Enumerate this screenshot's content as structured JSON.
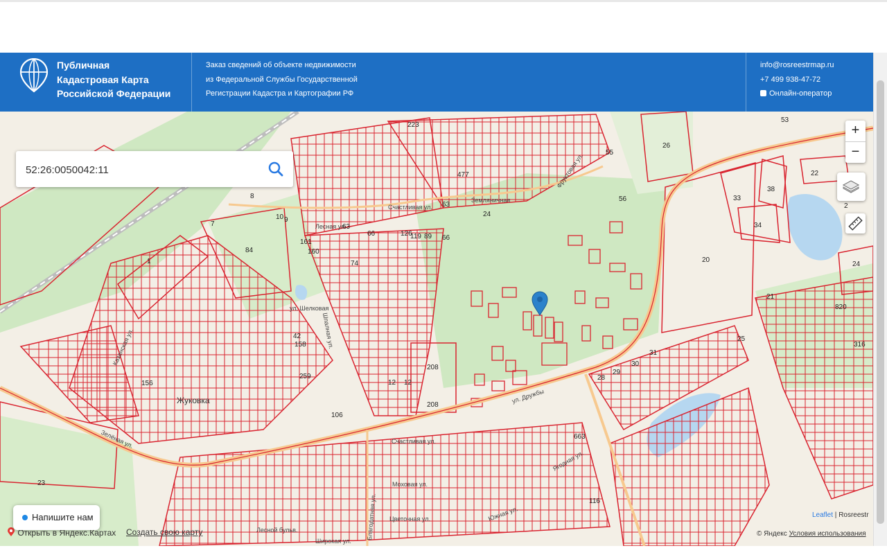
{
  "header": {
    "brand_line1": "Публичная",
    "brand_line2": "Кадастровая Карта",
    "brand_line3": "Российской Федерации",
    "order_line1": "Заказ сведений об объекте недвижимости",
    "order_line2": "из Федеральной Службы Государственной",
    "order_line3": "Регистрации Кадастра и Картографии РФ",
    "email": "info@rosreestrmap.ru",
    "phone": "+7 499 938-47-72",
    "operator": "Онлайн-оператор"
  },
  "search": {
    "value": "52:26:0050042:11"
  },
  "controls": {
    "zoom_in": "+",
    "zoom_out": "−"
  },
  "chat": {
    "label": "Напишите нам"
  },
  "yandex": {
    "open": "Открыть в Яндекс.Картах",
    "create": "Создать свою карту",
    "copyright": "© Яндекс",
    "terms": "Условия использования"
  },
  "attribution": {
    "leaflet": "Leaflet",
    "sep": " | ",
    "rosreestr": "Rosreestr"
  },
  "map_labels": {
    "l53": "53",
    "l26": "26",
    "l55": "55",
    "l22": "22",
    "l38": "38",
    "l33": "33",
    "l34": "34",
    "l56": "56",
    "l63": "63",
    "l24": "24",
    "l66a": "66",
    "l66b": "66",
    "l161": "161",
    "l160": "160",
    "l84": "84",
    "l8": "8",
    "l7": "7",
    "l1": "1",
    "l20": "20",
    "l21": "21",
    "l820": "820",
    "l316": "316",
    "l24b": "24",
    "l208a": "208",
    "l208b": "208",
    "l12a": "12",
    "l12b": "12",
    "l28": "28",
    "l29": "29",
    "l30": "30",
    "l31": "31",
    "l25": "25",
    "l106": "106",
    "l259": "259",
    "l156": "156",
    "l158": "158",
    "l42": "42",
    "l74": "74",
    "l126": "126",
    "l119": "119",
    "l89": "89",
    "l223": "223",
    "l477": "477",
    "l663": "663",
    "l116": "116",
    "l23": "23",
    "l9": "9",
    "l10": "10",
    "l2": "2",
    "l63b": "63"
  },
  "street_labels": {
    "zemlyanichnaya": "Земляничная",
    "schastlivaya_top": "Счастливая ул.",
    "lesnaya": "Лесная ул.",
    "frukt": "Фруктовая ул.",
    "schastlivaya": "Счастливая ул.",
    "mokhovaya": "Моховая ул.",
    "tsvetochnaya": "Цветочная ул.",
    "blagodatnaya": "Благодатная ул.",
    "lesnoy_bulvar": "Лесной бульв.",
    "shirokaya": "Широкая ул.",
    "yagodnaya": "Ягодная ул.",
    "zelenaya": "Зелёная ул.",
    "yuzhnaya": "Южная ул.",
    "shpalnaya": "Шпалная ул.",
    "kazanskaya": "Казанская ул.",
    "shelkovaya": "ул. Шелковая",
    "druzhby": "ул. Дружбы",
    "zhukovka": "Жуковка"
  },
  "colors": {
    "header": "#1e6fc4",
    "parcel": "#d9232f",
    "forest": "#cfe8c2",
    "water": "#b6d7f0",
    "road": "#f7c98f"
  }
}
